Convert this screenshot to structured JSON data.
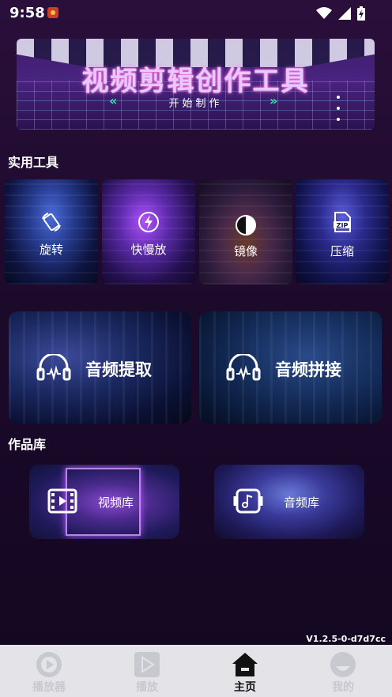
{
  "status_bar": {
    "time": "9:58"
  },
  "banner": {
    "title": "视频剪辑创作工具",
    "subtitle": "开始制作",
    "arrow_left": "«",
    "arrow_right": "»"
  },
  "sections": {
    "tools_title": "实用工具",
    "works_title": "作品库"
  },
  "tools": [
    {
      "label": "旋转",
      "icon": "rotate-icon"
    },
    {
      "label": "快慢放",
      "icon": "speed-icon"
    },
    {
      "label": "镜像",
      "icon": "mirror-icon"
    },
    {
      "label": "压缩",
      "icon": "zip-icon"
    }
  ],
  "audio_tools": [
    {
      "label": "音频提取",
      "icon": "headphones-icon"
    },
    {
      "label": "音频拼接",
      "icon": "headphones-icon"
    }
  ],
  "library": [
    {
      "label": "视频库",
      "icon": "film-icon"
    },
    {
      "label": "音频库",
      "icon": "music-note-icon"
    }
  ],
  "version": "V1.2.5-0-d7d7cc",
  "bottom_nav": {
    "items": [
      {
        "label": "播放器",
        "icon": "play-circle-icon",
        "active": false
      },
      {
        "label": "播放",
        "icon": "play-square-icon",
        "active": false
      },
      {
        "label": "主页",
        "icon": "home-icon",
        "active": true
      },
      {
        "label": "我的",
        "icon": "profile-icon",
        "active": false
      }
    ]
  },
  "colors": {
    "background": "#1d0a2c",
    "accent_green": "#36e3a6",
    "nav_bg": "#e3e3e8",
    "nav_inactive": "#c8c8d0",
    "nav_active": "#111111"
  }
}
